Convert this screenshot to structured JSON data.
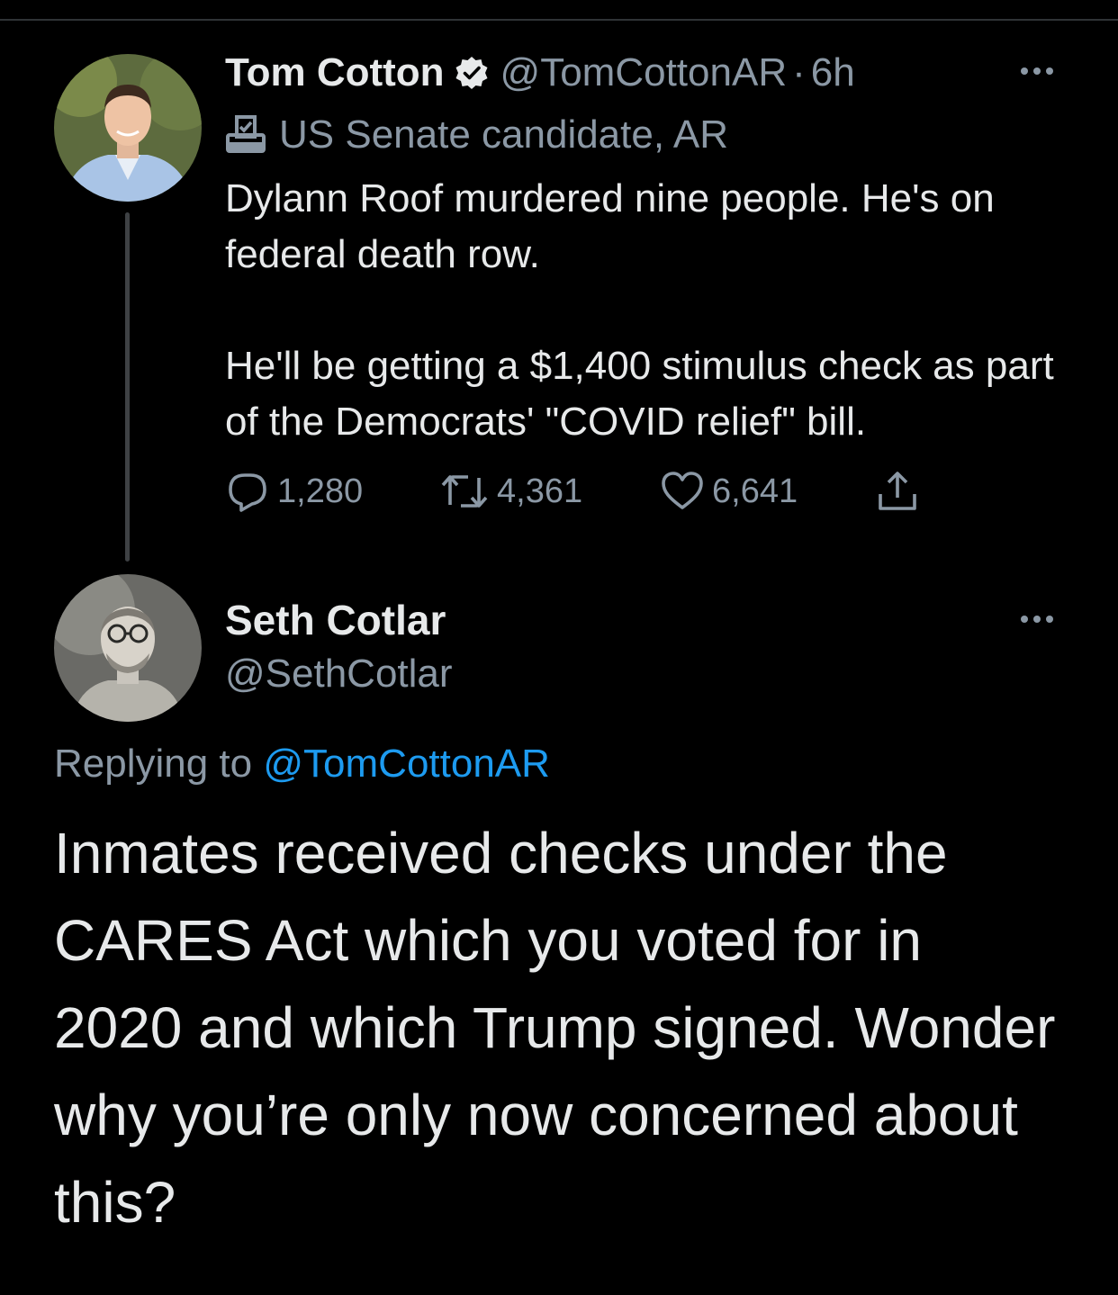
{
  "colors": {
    "background": "#000000",
    "primary_text": "#e7e9ea",
    "secondary_text": "#8b98a5",
    "link": "#1d9bf0",
    "thread_line": "#3e4144"
  },
  "tweet": {
    "author_name": "Tom Cotton",
    "verified": true,
    "handle": "@TomCottonAR",
    "separator": "·",
    "time": "6h",
    "label_icon": "ballot-box-icon",
    "label": "US Senate candidate, AR",
    "text_para_1": "Dylann Roof murdered nine people. He's on federal death row.",
    "text_para_2": "He'll be getting a $1,400 stimulus check as part of the Democrats' \"COVID relief\" bill.",
    "replies": "1,280",
    "retweets": "4,361",
    "likes": "6,641"
  },
  "reply": {
    "author_name": "Seth Cotlar",
    "handle": "@SethCotlar",
    "replying_to_prefix": "Replying to",
    "replying_to_handle": "@TomCottonAR",
    "text": "Inmates received checks under the CARES Act which you voted for in 2020 and which Trump signed. Wonder why you’re only now concerned about this?"
  }
}
